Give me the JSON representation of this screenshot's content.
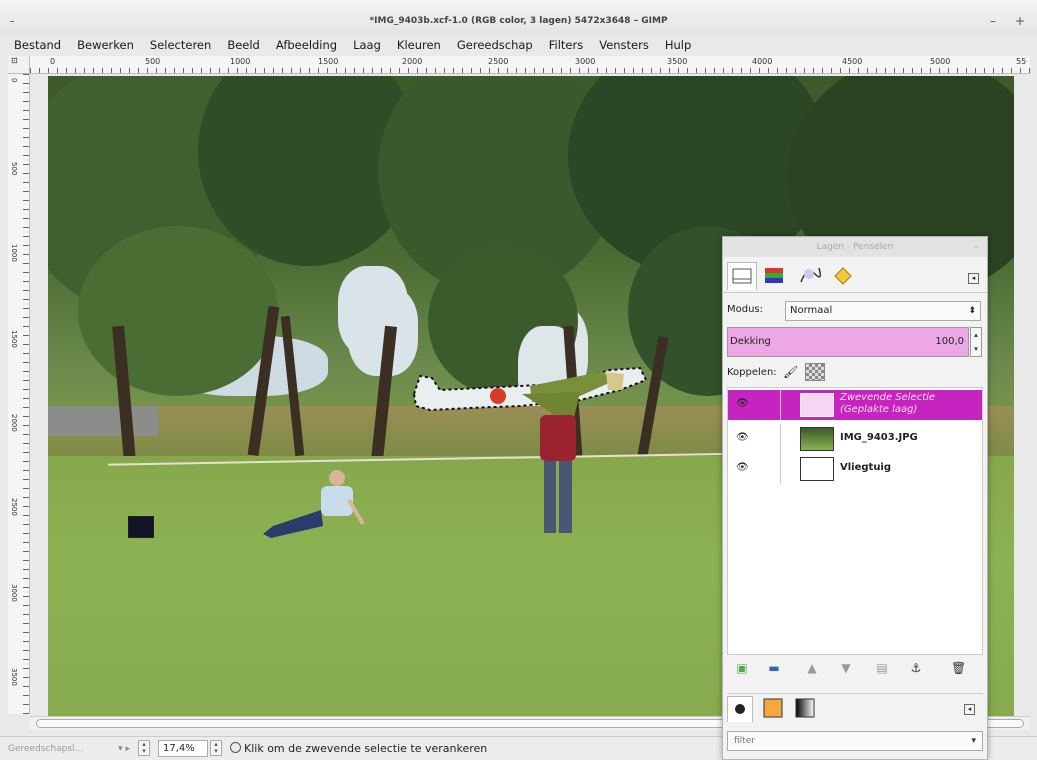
{
  "window": {
    "title": "*IMG_9403b.xcf-1.0 (RGB color, 3 lagen) 5472x3648 – GIMP",
    "menu_icon": "-",
    "minimize": "–",
    "maximize": "+"
  },
  "menubar": [
    "Bestand",
    "Bewerken",
    "Selecteren",
    "Beeld",
    "Afbeelding",
    "Laag",
    "Kleuren",
    "Gereedschap",
    "Filters",
    "Vensters",
    "Hulp"
  ],
  "ruler": {
    "h_ticks": [
      "0",
      "500",
      "1000",
      "1500",
      "2000",
      "2500",
      "3000",
      "3500",
      "4000",
      "4500",
      "5000",
      "55"
    ],
    "v_ticks": [
      "0",
      "500",
      "1000",
      "1500",
      "2000",
      "2500",
      "3000",
      "3500"
    ]
  },
  "status": {
    "unit": "Gereedschapsl...",
    "zoom": "17,4%",
    "message": "Klik om de zwevende selectie te verankeren"
  },
  "dock": {
    "title": "Lagen - Penselen",
    "mode_label": "Modus:",
    "mode_value": "Normaal",
    "opacity_label": "Dekking",
    "opacity_value": "100,0",
    "opacity_fraction": 1.0,
    "lock_label": "Koppelen:",
    "layers": [
      {
        "name": "Zwevende Selectie (Geplakte laag)",
        "selected": true
      },
      {
        "name": "IMG_9403.JPG",
        "selected": false
      },
      {
        "name": "Vliegtuig",
        "selected": false
      }
    ],
    "brush_filter": "filter"
  },
  "colors": {
    "selected_layer": "#c524c0",
    "opacity_bar": "#eda6e6"
  }
}
